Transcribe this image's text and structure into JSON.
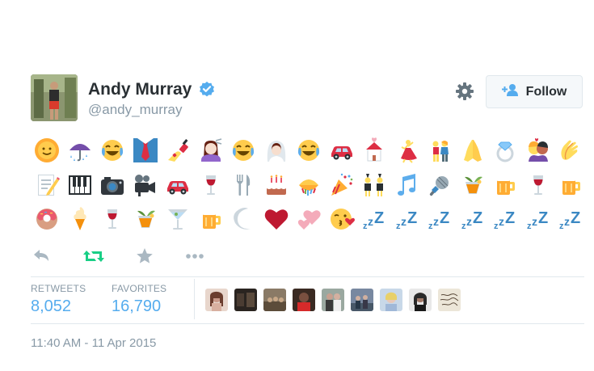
{
  "tweet": {
    "author_name": "Andy Murray",
    "author_handle": "@andy_murray",
    "follow_label": "Follow",
    "emoji_rows": [
      [
        "sun-with-face",
        "umbrella-with-rain",
        "face-with-tears-of-joy",
        "necktie",
        "nail-polish",
        "haircut",
        "face-with-tears-of-joy",
        "bride-with-veil",
        "face-with-tears-of-joy",
        "automobile",
        "wedding-chapel",
        "dancer",
        "man-and-woman",
        "folded-hands",
        "ring",
        "kiss",
        "clapping-hands"
      ],
      [
        "memo",
        "musical-keyboard",
        "camera",
        "movie-camera",
        "automobile",
        "wine-glass",
        "fork-and-knife",
        "birthday-cake",
        "confetti-ball",
        "party-popper",
        "dancers-with-bunny-ears",
        "musical-notes",
        "microphone",
        "tropical-drink",
        "beer-mug",
        "wine-glass",
        "beer-mug"
      ],
      [
        "doughnut",
        "soft-ice-cream",
        "wine-glass",
        "tropical-drink",
        "cocktail-glass",
        "beer-mug",
        "crescent-moon",
        "heart",
        "two-hearts",
        "face-throwing-kiss",
        "sleeping-zzz",
        "sleeping-zzz",
        "sleeping-zzz",
        "sleeping-zzz",
        "sleeping-zzz",
        "sleeping-zzz",
        "sleeping-zzz"
      ]
    ],
    "actions": [
      "reply-icon",
      "retweet-icon",
      "favorite-icon",
      "more-icon"
    ],
    "retweets_label": "RETWEETS",
    "retweets_count": "8,052",
    "favorites_label": "FAVORITES",
    "favorites_count": "16,790",
    "favorited_by_count": 9,
    "timestamp": "11:40 AM - 11 Apr 2015"
  },
  "colors": {
    "accent": "#55acee",
    "retweet_green": "#19cf86",
    "muted": "#8899a6",
    "text": "#292f33"
  }
}
